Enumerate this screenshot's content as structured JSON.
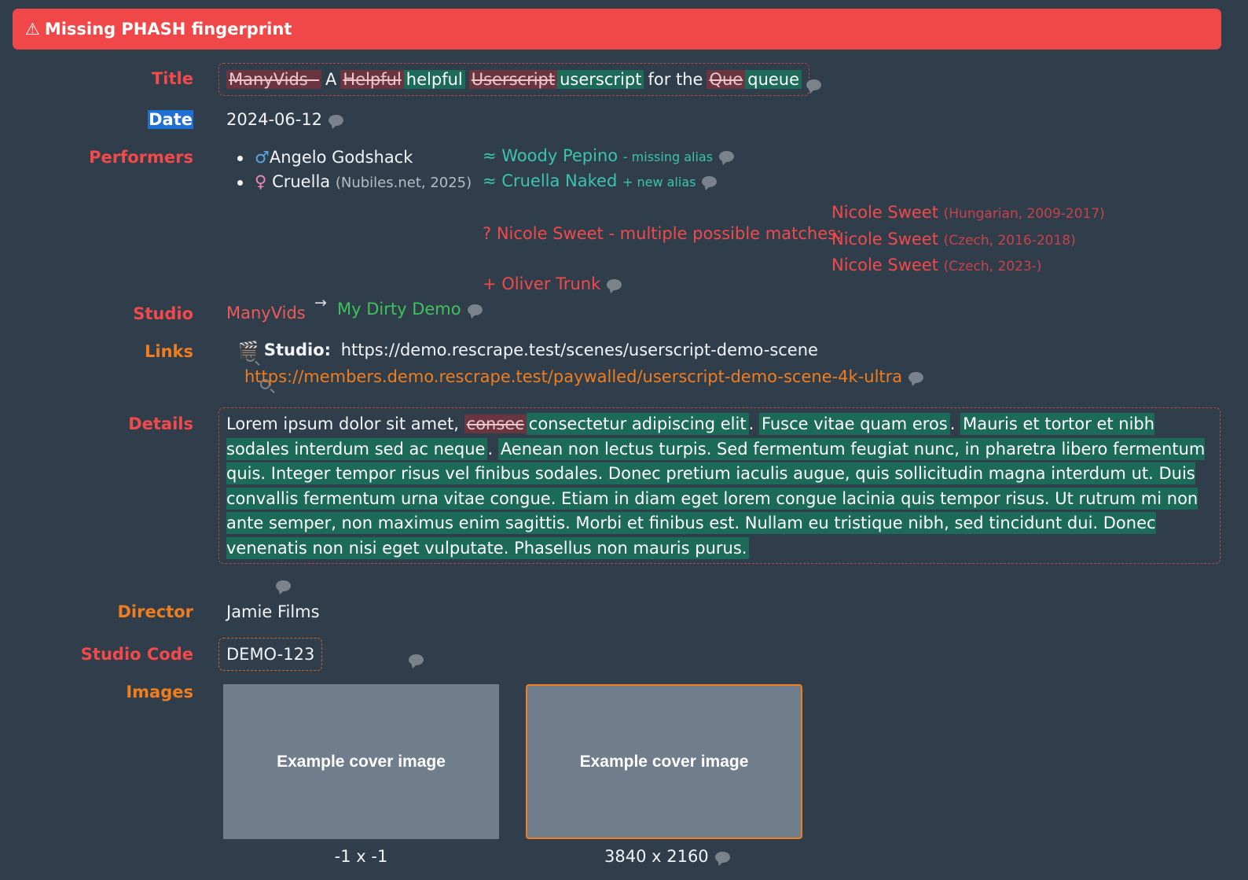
{
  "banner": {
    "icon": "warning-icon",
    "text": "Missing PHASH fingerprint"
  },
  "labels": {
    "title": "Title",
    "date": "Date",
    "performers": "Performers",
    "studio": "Studio",
    "links": "Links",
    "details": "Details",
    "director": "Director",
    "studio_code": "Studio Code",
    "images": "Images"
  },
  "title": {
    "del1": "ManyVids - ",
    "plain1": "A",
    "del2": "Helpful",
    "ins2": "helpful",
    "del3": "Userscript",
    "ins3": "userscript",
    "plain3": "for the",
    "del4": "Que",
    "ins4": "queue"
  },
  "date": "2024-06-12",
  "performers": {
    "existing": [
      {
        "gender_icon": "male-icon",
        "symbol": "♂",
        "name": "Angelo Godshack",
        "sub": ""
      },
      {
        "gender_icon": "female-icon",
        "symbol": "♀",
        "name": "Cruella",
        "sub": "(Nubiles.net, 2025)"
      }
    ],
    "matches": [
      {
        "prefix": "≈",
        "name": "Woody Pepino",
        "note": "- missing alias"
      },
      {
        "prefix": "≈",
        "name": "Cruella Naked",
        "note": "+ new alias"
      }
    ],
    "ambiguous": {
      "text": "? Nicole Sweet - multiple possible matches:",
      "options": [
        {
          "name": "Nicole Sweet",
          "sub": "(Hungarian, 2009-2017)"
        },
        {
          "name": "Nicole Sweet",
          "sub": "(Czech, 2016-2018)"
        },
        {
          "name": "Nicole Sweet",
          "sub": "(Czech, 2023-)"
        }
      ]
    },
    "new": "+ Oliver Trunk"
  },
  "studio": {
    "old": "ManyVids",
    "arrow": "→",
    "new": "My Dirty Demo"
  },
  "links": {
    "studio_icon": "🎬",
    "studio_label": "Studio:",
    "studio_url": "https://demo.rescrape.test/scenes/userscript-demo-scene",
    "new_url": "https://members.demo.rescrape.test/paywalled/userscript-demo-scene-4k-ultra"
  },
  "details": {
    "p1": "Lorem ipsum dolor sit amet,",
    "del1": "consec",
    "ins1": "consectetur adipiscing elit",
    "p2": ".",
    "ins2": "Fusce vitae quam eros",
    "p3": ".",
    "ins3": "Mauris et tortor et nibh sodales interdum sed ac neque",
    "p4": ".",
    "ins4": "Aenean non lectus turpis. Sed fermentum feugiat nunc, in pharetra libero fermentum quis. Integer tempor risus vel finibus sodales. Donec pretium iaculis augue, quis sollicitudin magna interdum ut. Duis convallis fermentum urna vitae congue. Etiam in diam eget lorem congue lacinia quis tempor risus. Ut rutrum mi non ante semper, non maximus enim sagittis. Morbi et finibus est. Nullam eu tristique nibh, sed tincidunt dui. Donec venenatis non nisi eget vulputate. Phasellus non mauris purus."
  },
  "director": "Jamie Films",
  "studio_code": "DEMO-123",
  "images": [
    {
      "text": "Example cover image",
      "caption": "-1 x -1"
    },
    {
      "text": "Example cover image",
      "caption": "3840 x 2160"
    }
  ],
  "colors": {
    "background": "#303d4a",
    "banner": "#f04848",
    "deletion_bg": "#6b3540",
    "insertion_bg": "#1c6b58",
    "red_label": "#f24a4a",
    "orange_label": "#f07d1e",
    "teal": "#3bc4b0",
    "green": "#3fc25c"
  }
}
